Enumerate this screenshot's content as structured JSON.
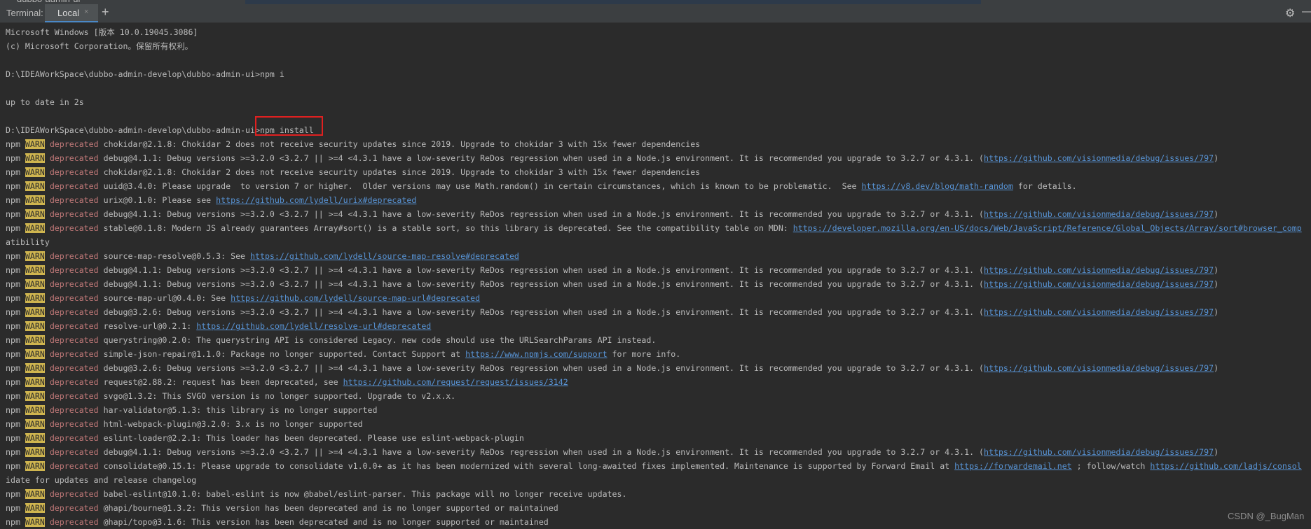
{
  "window": {
    "top_fragment": "dubbo-admin-ui"
  },
  "tabbar": {
    "label": "Terminal:",
    "active_tab": "Local",
    "close_glyph": "×",
    "new_tab_glyph": "+",
    "settings_icon": "gear-icon",
    "settings_glyph": "⚙",
    "hide_icon": "minus-icon",
    "hide_glyph": "—"
  },
  "colors": {
    "background": "#2b2b2b",
    "text": "#bbbbbb",
    "warn_bg": "#cfb54f",
    "deprecated": "#c07878",
    "link": "#5894d6",
    "highlight_box": "#e02020"
  },
  "terminal": {
    "lines": [
      {
        "segs": [
          {
            "t": "Microsoft Windows [版本 10.0.19045.3086]",
            "c": "t"
          }
        ]
      },
      {
        "segs": [
          {
            "t": "(c) Microsoft Corporation。保留所有权利。",
            "c": "t"
          }
        ]
      },
      {
        "segs": []
      },
      {
        "segs": [
          {
            "t": "D:\\IDEAWorkSpace\\dubbo-admin-develop\\dubbo-admin-ui>npm i",
            "c": "t"
          }
        ]
      },
      {
        "segs": []
      },
      {
        "segs": [
          {
            "t": "up to date in 2s",
            "c": "t"
          }
        ]
      },
      {
        "segs": []
      },
      {
        "segs": [
          {
            "t": "D:\\IDEAWorkSpace\\dubbo-admin-develop\\dubbo-admin-ui>npm install",
            "c": "t"
          }
        ]
      },
      {
        "segs": [
          {
            "t": "npm ",
            "c": "t"
          },
          {
            "t": "WARN",
            "c": "w"
          },
          {
            "t": " deprecated",
            "c": "d"
          },
          {
            "t": " chokidar@2.1.8: Chokidar 2 does not receive security updates since 2019. Upgrade to chokidar 3 with 15x fewer dependencies",
            "c": "t"
          }
        ]
      },
      {
        "segs": [
          {
            "t": "npm ",
            "c": "t"
          },
          {
            "t": "WARN",
            "c": "w"
          },
          {
            "t": " deprecated",
            "c": "d"
          },
          {
            "t": " debug@4.1.1: Debug versions >=3.2.0 <3.2.7 || >=4 <4.3.1 have a low-severity ReDos regression when used in a Node.js environment. It is recommended you upgrade to 3.2.7 or 4.3.1. (",
            "c": "t"
          },
          {
            "t": "https://github.com/visionmedia/debug/issues/797",
            "c": "l"
          },
          {
            "t": ")",
            "c": "t"
          }
        ]
      },
      {
        "segs": [
          {
            "t": "npm ",
            "c": "t"
          },
          {
            "t": "WARN",
            "c": "w"
          },
          {
            "t": " deprecated",
            "c": "d"
          },
          {
            "t": " chokidar@2.1.8: Chokidar 2 does not receive security updates since 2019. Upgrade to chokidar 3 with 15x fewer dependencies",
            "c": "t"
          }
        ]
      },
      {
        "segs": [
          {
            "t": "npm ",
            "c": "t"
          },
          {
            "t": "WARN",
            "c": "w"
          },
          {
            "t": " deprecated",
            "c": "d"
          },
          {
            "t": " uuid@3.4.0: Please upgrade  to version 7 or higher.  Older versions may use Math.random() in certain circumstances, which is known to be problematic.  See ",
            "c": "t"
          },
          {
            "t": "https://v8.dev/blog/math-random",
            "c": "l"
          },
          {
            "t": " for details.",
            "c": "t"
          }
        ]
      },
      {
        "segs": [
          {
            "t": "npm ",
            "c": "t"
          },
          {
            "t": "WARN",
            "c": "w"
          },
          {
            "t": " deprecated",
            "c": "d"
          },
          {
            "t": " urix@0.1.0: Please see ",
            "c": "t"
          },
          {
            "t": "https://github.com/lydell/urix#deprecated",
            "c": "l"
          }
        ]
      },
      {
        "segs": [
          {
            "t": "npm ",
            "c": "t"
          },
          {
            "t": "WARN",
            "c": "w"
          },
          {
            "t": " deprecated",
            "c": "d"
          },
          {
            "t": " debug@4.1.1: Debug versions >=3.2.0 <3.2.7 || >=4 <4.3.1 have a low-severity ReDos regression when used in a Node.js environment. It is recommended you upgrade to 3.2.7 or 4.3.1. (",
            "c": "t"
          },
          {
            "t": "https://github.com/visionmedia/debug/issues/797",
            "c": "l"
          },
          {
            "t": ")",
            "c": "t"
          }
        ]
      },
      {
        "segs": [
          {
            "t": "npm ",
            "c": "t"
          },
          {
            "t": "WARN",
            "c": "w"
          },
          {
            "t": " deprecated",
            "c": "d"
          },
          {
            "t": " stable@0.1.8: Modern JS already guarantees Array#sort() is a stable sort, so this library is deprecated. See the compatibility table on MDN: ",
            "c": "t"
          },
          {
            "t": "https://developer.mozilla.org/en-US/docs/Web/JavaScript/Reference/Global_Objects/Array/sort#browser_comp",
            "c": "l"
          }
        ]
      },
      {
        "segs": [
          {
            "t": "atibility",
            "c": "t"
          }
        ]
      },
      {
        "segs": [
          {
            "t": "npm ",
            "c": "t"
          },
          {
            "t": "WARN",
            "c": "w"
          },
          {
            "t": " deprecated",
            "c": "d"
          },
          {
            "t": " source-map-resolve@0.5.3: See ",
            "c": "t"
          },
          {
            "t": "https://github.com/lydell/source-map-resolve#deprecated",
            "c": "l"
          }
        ]
      },
      {
        "segs": [
          {
            "t": "npm ",
            "c": "t"
          },
          {
            "t": "WARN",
            "c": "w"
          },
          {
            "t": " deprecated",
            "c": "d"
          },
          {
            "t": " debug@4.1.1: Debug versions >=3.2.0 <3.2.7 || >=4 <4.3.1 have a low-severity ReDos regression when used in a Node.js environment. It is recommended you upgrade to 3.2.7 or 4.3.1. (",
            "c": "t"
          },
          {
            "t": "https://github.com/visionmedia/debug/issues/797",
            "c": "l"
          },
          {
            "t": ")",
            "c": "t"
          }
        ]
      },
      {
        "segs": [
          {
            "t": "npm ",
            "c": "t"
          },
          {
            "t": "WARN",
            "c": "w"
          },
          {
            "t": " deprecated",
            "c": "d"
          },
          {
            "t": " debug@4.1.1: Debug versions >=3.2.0 <3.2.7 || >=4 <4.3.1 have a low-severity ReDos regression when used in a Node.js environment. It is recommended you upgrade to 3.2.7 or 4.3.1. (",
            "c": "t"
          },
          {
            "t": "https://github.com/visionmedia/debug/issues/797",
            "c": "l"
          },
          {
            "t": ")",
            "c": "t"
          }
        ]
      },
      {
        "segs": [
          {
            "t": "npm ",
            "c": "t"
          },
          {
            "t": "WARN",
            "c": "w"
          },
          {
            "t": " deprecated",
            "c": "d"
          },
          {
            "t": " source-map-url@0.4.0: See ",
            "c": "t"
          },
          {
            "t": "https://github.com/lydell/source-map-url#deprecated",
            "c": "l"
          }
        ]
      },
      {
        "segs": [
          {
            "t": "npm ",
            "c": "t"
          },
          {
            "t": "WARN",
            "c": "w"
          },
          {
            "t": " deprecated",
            "c": "d"
          },
          {
            "t": " debug@3.2.6: Debug versions >=3.2.0 <3.2.7 || >=4 <4.3.1 have a low-severity ReDos regression when used in a Node.js environment. It is recommended you upgrade to 3.2.7 or 4.3.1. (",
            "c": "t"
          },
          {
            "t": "https://github.com/visionmedia/debug/issues/797",
            "c": "l"
          },
          {
            "t": ")",
            "c": "t"
          }
        ]
      },
      {
        "segs": [
          {
            "t": "npm ",
            "c": "t"
          },
          {
            "t": "WARN",
            "c": "w"
          },
          {
            "t": " deprecated",
            "c": "d"
          },
          {
            "t": " resolve-url@0.2.1: ",
            "c": "t"
          },
          {
            "t": "https://github.com/lydell/resolve-url#deprecated",
            "c": "l"
          }
        ]
      },
      {
        "segs": [
          {
            "t": "npm ",
            "c": "t"
          },
          {
            "t": "WARN",
            "c": "w"
          },
          {
            "t": " deprecated",
            "c": "d"
          },
          {
            "t": " querystring@0.2.0: The querystring API is considered Legacy. new code should use the URLSearchParams API instead.",
            "c": "t"
          }
        ]
      },
      {
        "segs": [
          {
            "t": "npm ",
            "c": "t"
          },
          {
            "t": "WARN",
            "c": "w"
          },
          {
            "t": " deprecated",
            "c": "d"
          },
          {
            "t": " simple-json-repair@1.1.0: Package no longer supported. Contact Support at ",
            "c": "t"
          },
          {
            "t": "https://www.npmjs.com/support",
            "c": "l"
          },
          {
            "t": " for more info.",
            "c": "t"
          }
        ]
      },
      {
        "segs": [
          {
            "t": "npm ",
            "c": "t"
          },
          {
            "t": "WARN",
            "c": "w"
          },
          {
            "t": " deprecated",
            "c": "d"
          },
          {
            "t": " debug@3.2.6: Debug versions >=3.2.0 <3.2.7 || >=4 <4.3.1 have a low-severity ReDos regression when used in a Node.js environment. It is recommended you upgrade to 3.2.7 or 4.3.1. (",
            "c": "t"
          },
          {
            "t": "https://github.com/visionmedia/debug/issues/797",
            "c": "l"
          },
          {
            "t": ")",
            "c": "t"
          }
        ]
      },
      {
        "segs": [
          {
            "t": "npm ",
            "c": "t"
          },
          {
            "t": "WARN",
            "c": "w"
          },
          {
            "t": " deprecated",
            "c": "d"
          },
          {
            "t": " request@2.88.2: request has been deprecated, see ",
            "c": "t"
          },
          {
            "t": "https://github.com/request/request/issues/3142",
            "c": "l"
          }
        ]
      },
      {
        "segs": [
          {
            "t": "npm ",
            "c": "t"
          },
          {
            "t": "WARN",
            "c": "w"
          },
          {
            "t": " deprecated",
            "c": "d"
          },
          {
            "t": " svgo@1.3.2: This SVGO version is no longer supported. Upgrade to v2.x.x.",
            "c": "t"
          }
        ]
      },
      {
        "segs": [
          {
            "t": "npm ",
            "c": "t"
          },
          {
            "t": "WARN",
            "c": "w"
          },
          {
            "t": " deprecated",
            "c": "d"
          },
          {
            "t": " har-validator@5.1.3: this library is no longer supported",
            "c": "t"
          }
        ]
      },
      {
        "segs": [
          {
            "t": "npm ",
            "c": "t"
          },
          {
            "t": "WARN",
            "c": "w"
          },
          {
            "t": " deprecated",
            "c": "d"
          },
          {
            "t": " html-webpack-plugin@3.2.0: 3.x is no longer supported",
            "c": "t"
          }
        ]
      },
      {
        "segs": [
          {
            "t": "npm ",
            "c": "t"
          },
          {
            "t": "WARN",
            "c": "w"
          },
          {
            "t": " deprecated",
            "c": "d"
          },
          {
            "t": " eslint-loader@2.2.1: This loader has been deprecated. Please use eslint-webpack-plugin",
            "c": "t"
          }
        ]
      },
      {
        "segs": [
          {
            "t": "npm ",
            "c": "t"
          },
          {
            "t": "WARN",
            "c": "w"
          },
          {
            "t": " deprecated",
            "c": "d"
          },
          {
            "t": " debug@4.1.1: Debug versions >=3.2.0 <3.2.7 || >=4 <4.3.1 have a low-severity ReDos regression when used in a Node.js environment. It is recommended you upgrade to 3.2.7 or 4.3.1. (",
            "c": "t"
          },
          {
            "t": "https://github.com/visionmedia/debug/issues/797",
            "c": "l"
          },
          {
            "t": ")",
            "c": "t"
          }
        ]
      },
      {
        "segs": [
          {
            "t": "npm ",
            "c": "t"
          },
          {
            "t": "WARN",
            "c": "w"
          },
          {
            "t": " deprecated",
            "c": "d"
          },
          {
            "t": " consolidate@0.15.1: Please upgrade to consolidate v1.0.0+ as it has been modernized with several long-awaited fixes implemented. Maintenance is supported by Forward Email at ",
            "c": "t"
          },
          {
            "t": "https://forwardemail.net",
            "c": "l"
          },
          {
            "t": " ; follow/watch ",
            "c": "t"
          },
          {
            "t": "https://github.com/ladjs/consol",
            "c": "l"
          }
        ]
      },
      {
        "segs": [
          {
            "t": "idate for updates and release changelog",
            "c": "t"
          }
        ]
      },
      {
        "segs": [
          {
            "t": "npm ",
            "c": "t"
          },
          {
            "t": "WARN",
            "c": "w"
          },
          {
            "t": " deprecated",
            "c": "d"
          },
          {
            "t": " babel-eslint@10.1.0: babel-eslint is now @babel/eslint-parser. This package will no longer receive updates.",
            "c": "t"
          }
        ]
      },
      {
        "segs": [
          {
            "t": "npm ",
            "c": "t"
          },
          {
            "t": "WARN",
            "c": "w"
          },
          {
            "t": " deprecated",
            "c": "d"
          },
          {
            "t": " @hapi/bourne@1.3.2: This version has been deprecated and is no longer supported or maintained",
            "c": "t"
          }
        ]
      },
      {
        "segs": [
          {
            "t": "npm ",
            "c": "t"
          },
          {
            "t": "WARN",
            "c": "w"
          },
          {
            "t": " deprecated",
            "c": "d"
          },
          {
            "t": " @hapi/topo@3.1.6: This version has been deprecated and is no longer supported or maintained",
            "c": "t"
          }
        ]
      }
    ]
  },
  "watermark": "CSDN @_BugMan"
}
